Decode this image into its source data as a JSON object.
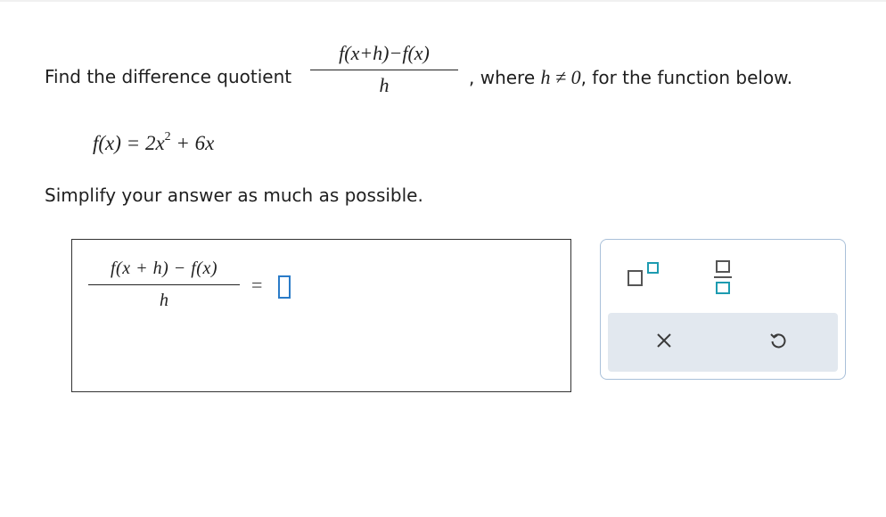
{
  "question": {
    "prefix": "Find the difference quotient",
    "quotient_numerator": "f(x+h)−f(x)",
    "quotient_denominator": "h",
    "suffix_text": ", where ",
    "condition": "h ≠ 0",
    "suffix_end": ", for the function below."
  },
  "function": {
    "lhs": "f(x) = 2x",
    "exponent": "2",
    "rhs": " + 6x"
  },
  "instruction": "Simplify your answer as much as possible.",
  "answer": {
    "numerator": "f(x + h) − f(x)",
    "denominator": "h",
    "equals": "=",
    "value": ""
  },
  "palette": {
    "buttons": [
      "exponent",
      "fraction",
      "clear",
      "undo"
    ],
    "accent_color": "#1d9bb0",
    "bar_color": "#e2e8ef"
  }
}
